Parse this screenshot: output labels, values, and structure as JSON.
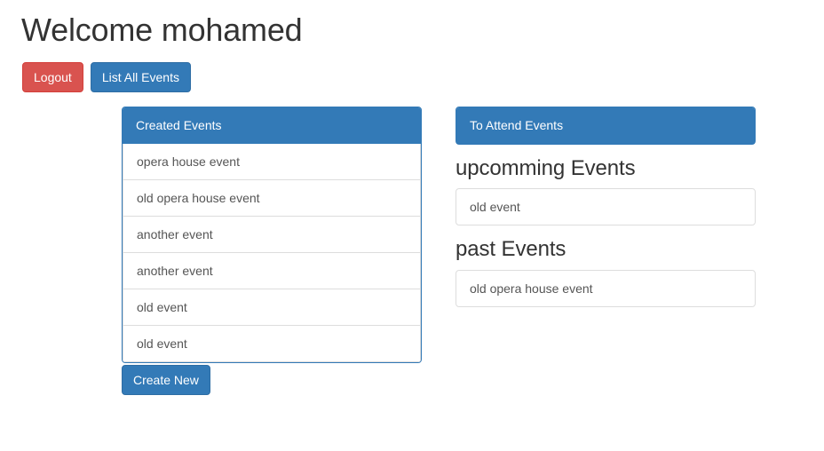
{
  "header": {
    "title": "Welcome mohamed",
    "buttons": [
      {
        "label": "Logout",
        "name": "logout-button",
        "style": "danger"
      },
      {
        "label": "List All Events",
        "name": "list-all-events-button",
        "style": "primary"
      }
    ]
  },
  "created_panel": {
    "title": "Created Events",
    "items": [
      "opera house event",
      "old opera house event",
      "another event",
      "another event",
      "old event",
      "old event"
    ],
    "create_button_label": "Create New"
  },
  "attend_panel": {
    "title": "To Attend Events",
    "upcoming": {
      "heading": "upcomming Events",
      "items": [
        "old event"
      ]
    },
    "past": {
      "heading": "past Events",
      "items": [
        "old opera house event"
      ]
    }
  },
  "colors": {
    "primary": "#337ab7",
    "primary_border": "#2e6da4",
    "danger": "#d9534f",
    "danger_border": "#d43f3a",
    "text": "#333333",
    "muted_text": "#555555",
    "border": "#dddddd",
    "background": "#ffffff"
  }
}
